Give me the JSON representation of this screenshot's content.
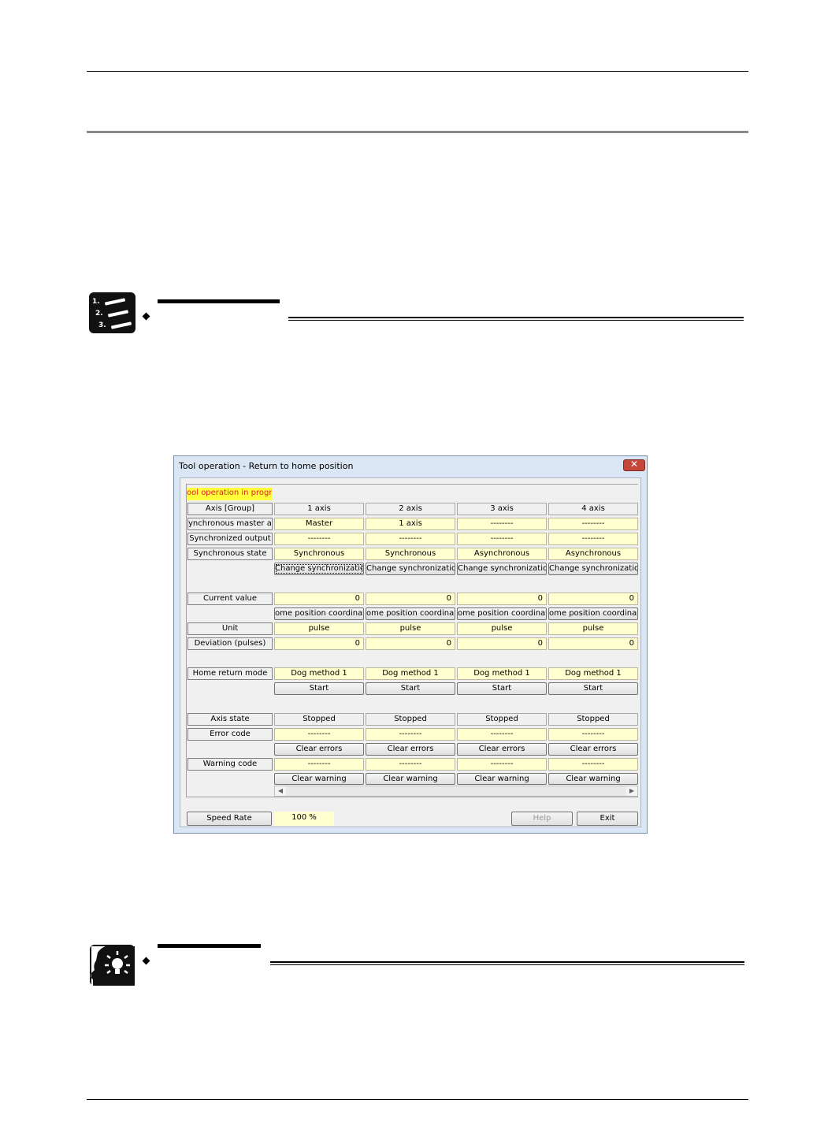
{
  "window": {
    "title": "Tool operation - Return to home position",
    "close_symbol": "✕",
    "status_text": "ool operation in progres"
  },
  "grid": {
    "header_label": "Axis [Group]",
    "axes": [
      "1 axis",
      "2 axis",
      "3 axis",
      "4 axis"
    ],
    "rows": {
      "sync_master": {
        "label": "ynchronous master axi",
        "values": [
          "Master",
          "1 axis",
          "--------",
          "--------"
        ]
      },
      "sync_output": {
        "label": "Synchronized output",
        "values": [
          "--------",
          "--------",
          "--------",
          "--------"
        ]
      },
      "sync_state": {
        "label": "Synchronous state",
        "values": [
          "Synchronous",
          "Synchronous",
          "Asynchronous",
          "Asynchronous"
        ]
      },
      "change_sync_button": "Change synchronization",
      "current_value": {
        "label": "Current value",
        "values": [
          "0",
          "0",
          "0",
          "0"
        ]
      },
      "home_coord_button": "ome position coordinate",
      "unit": {
        "label": "Unit",
        "values": [
          "pulse",
          "pulse",
          "pulse",
          "pulse"
        ]
      },
      "deviation": {
        "label": "Deviation (pulses)",
        "values": [
          "0",
          "0",
          "0",
          "0"
        ]
      },
      "home_return_mode": {
        "label": "Home return mode",
        "values": [
          "Dog method 1",
          "Dog method 1",
          "Dog method 1",
          "Dog method 1"
        ]
      },
      "start_button": "Start",
      "axis_state": {
        "label": "Axis state",
        "values": [
          "Stopped",
          "Stopped",
          "Stopped",
          "Stopped"
        ]
      },
      "error_code": {
        "label": "Error code",
        "values": [
          "--------",
          "--------",
          "--------",
          "--------"
        ]
      },
      "clear_errors_button": "Clear errors",
      "warning_code": {
        "label": "Warning code",
        "values": [
          "--------",
          "--------",
          "--------",
          "--------"
        ]
      },
      "clear_warning_button": "Clear warning"
    }
  },
  "footer": {
    "speed_rate_label": "Speed Rate",
    "speed_rate_value": "100 %",
    "help_label": "Help",
    "exit_label": "Exit"
  },
  "scroll": {
    "left_arrow": "◀",
    "right_arrow": "▶"
  }
}
